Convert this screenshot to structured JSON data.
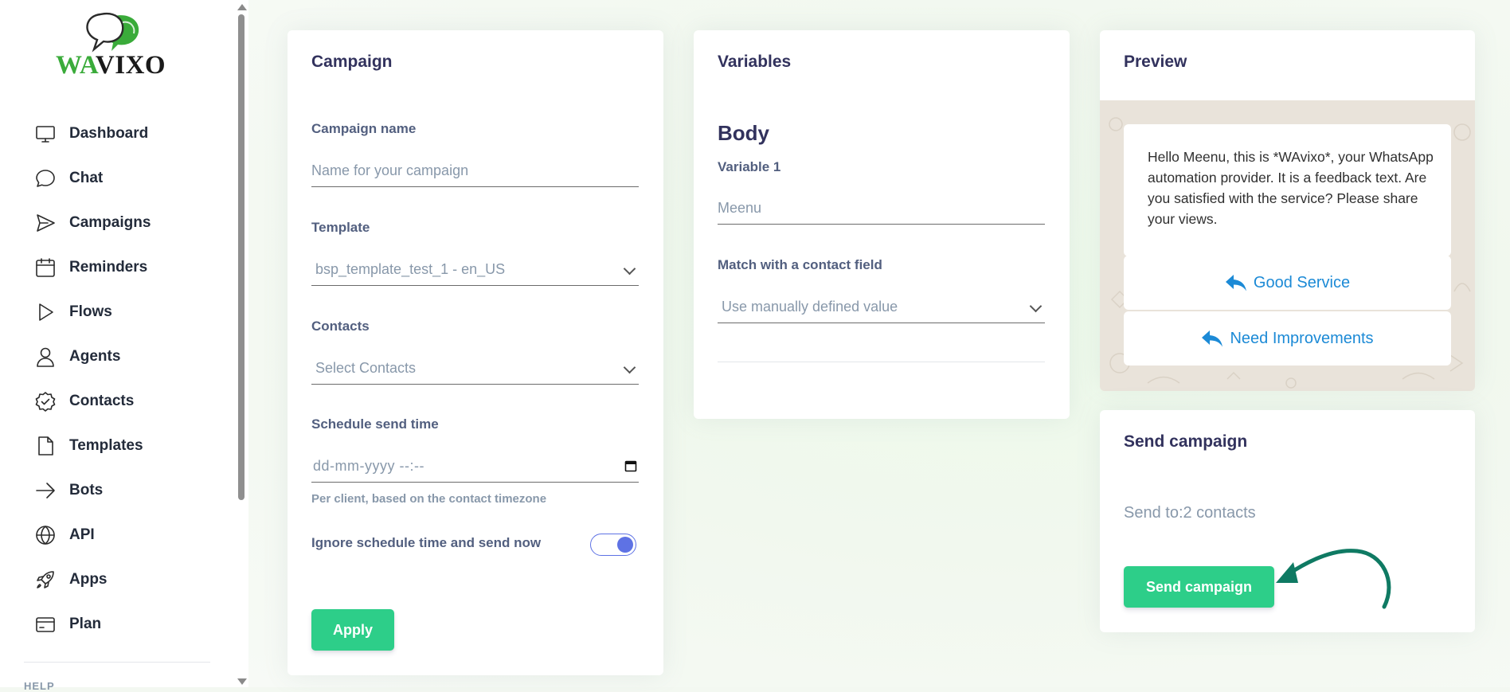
{
  "brand": {
    "wa": "WA",
    "vixo": "VIXO"
  },
  "sidebar": {
    "items": [
      {
        "label": "Dashboard",
        "icon": "monitor-icon"
      },
      {
        "label": "Chat",
        "icon": "chat-icon"
      },
      {
        "label": "Campaigns",
        "icon": "send-icon"
      },
      {
        "label": "Reminders",
        "icon": "calendar-icon"
      },
      {
        "label": "Flows",
        "icon": "play-icon"
      },
      {
        "label": "Agents",
        "icon": "user-icon"
      },
      {
        "label": "Contacts",
        "icon": "check-circle-icon"
      },
      {
        "label": "Templates",
        "icon": "file-icon"
      },
      {
        "label": "Bots",
        "icon": "arrow-right-icon"
      },
      {
        "label": "API",
        "icon": "globe-icon"
      },
      {
        "label": "Apps",
        "icon": "rocket-icon"
      },
      {
        "label": "Plan",
        "icon": "credit-card-icon"
      }
    ],
    "help_label": "HELP"
  },
  "campaign": {
    "title": "Campaign",
    "name_label": "Campaign name",
    "name_placeholder": "Name for your campaign",
    "template_label": "Template",
    "template_value": "bsp_template_test_1 - en_US",
    "contacts_label": "Contacts",
    "contacts_placeholder": "Select Contacts",
    "schedule_label": "Schedule send time",
    "schedule_placeholder": "dd-mm-yyyy --:--",
    "schedule_hint": "Per client, based on the contact timezone",
    "ignore_label": "Ignore schedule time and send now",
    "ignore_enabled": true,
    "apply_label": "Apply"
  },
  "variables": {
    "title": "Variables",
    "section": "Body",
    "variable_label": "Variable 1",
    "variable_placeholder": "Meenu",
    "match_label": "Match with a contact field",
    "match_value": "Use manually defined value"
  },
  "preview": {
    "title": "Preview",
    "message": "Hello Meenu, this is *WAvixo*, your WhatsApp automation provider. It is a feedback text. Are you satisfied with the service? Please share your views.",
    "buttons": [
      "Good Service",
      "Need Improvements"
    ]
  },
  "send": {
    "title": "Send campaign",
    "send_to": "Send to:2 contacts",
    "button_label": "Send campaign"
  },
  "colors": {
    "accent_green": "#2dce89",
    "toggle_blue": "#5e72e4",
    "reply_blue": "#1c8ad6",
    "arrow_teal": "#0f7a63"
  }
}
